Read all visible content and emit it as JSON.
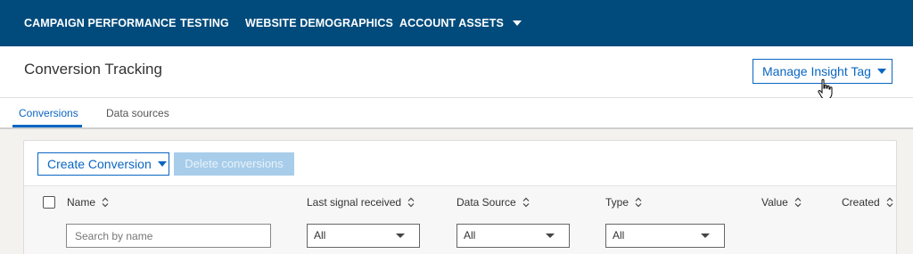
{
  "nav": {
    "items": [
      "CAMPAIGN PERFORMANCE",
      "TESTING",
      "WEBSITE DEMOGRAPHICS",
      "ACCOUNT ASSETS"
    ]
  },
  "header": {
    "title": "Conversion Tracking",
    "manage_label": "Manage Insight Tag"
  },
  "tabs": [
    "Conversions",
    "Data sources"
  ],
  "toolbar": {
    "create_label": "Create Conversion",
    "delete_label": "Delete conversions"
  },
  "table": {
    "columns": [
      "Name",
      "Last signal received",
      "Data Source",
      "Type",
      "Value",
      "Created"
    ]
  },
  "filters": {
    "search_placeholder": "Search by name",
    "last_signal": "All",
    "data_source": "All",
    "type": "All"
  },
  "colors": {
    "nav_bg": "#004b7c",
    "accent": "#0a66c2",
    "disabled_btn": "#a8cdea"
  }
}
